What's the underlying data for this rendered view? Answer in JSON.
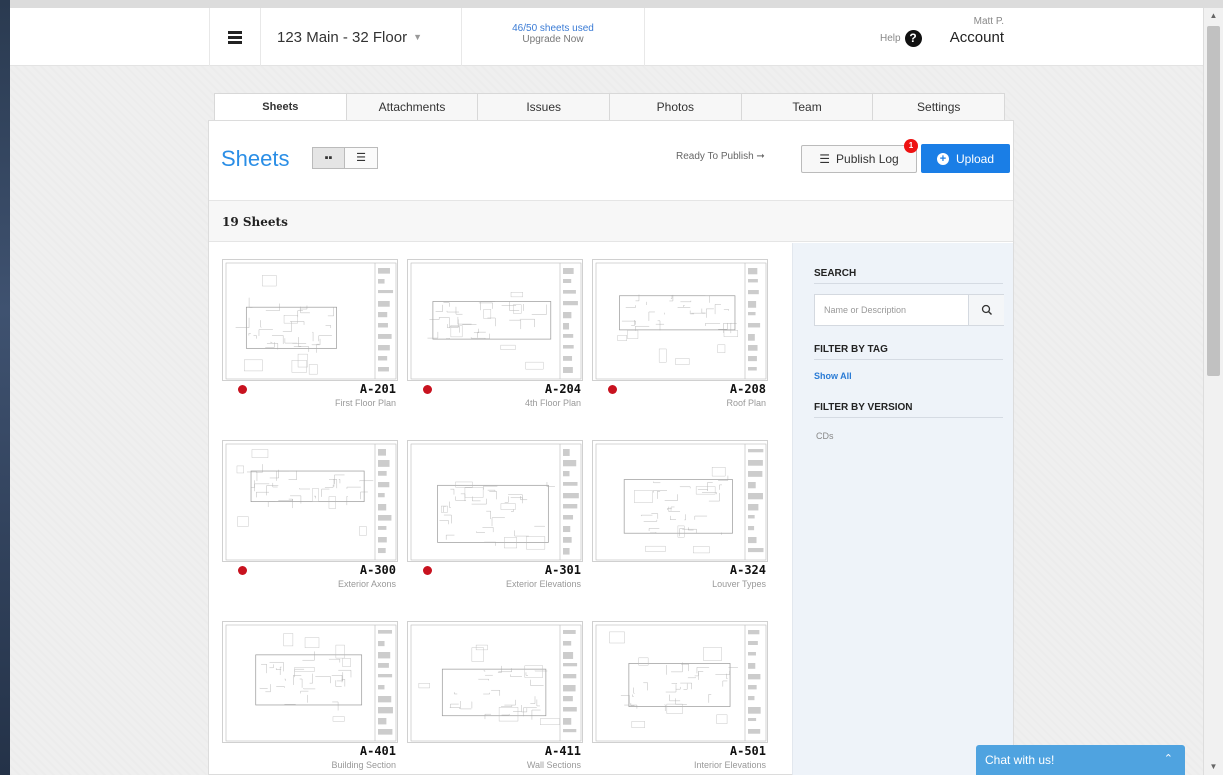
{
  "header": {
    "project_name": "123 Main - 32 Floor",
    "sheets_used": "46/50 sheets used",
    "upgrade": "Upgrade Now",
    "help": "Help",
    "user": "Matt P.",
    "account": "Account"
  },
  "tabs": [
    {
      "label": "Sheets",
      "active": true
    },
    {
      "label": "Attachments"
    },
    {
      "label": "Issues"
    },
    {
      "label": "Photos"
    },
    {
      "label": "Team"
    },
    {
      "label": "Settings"
    }
  ],
  "panel": {
    "title": "Sheets",
    "ready": "Ready To Publish ➞",
    "publish_log": "Publish Log",
    "publish_badge": "1",
    "upload": "Upload",
    "count": "19 Sheets"
  },
  "sheets": [
    {
      "code": "A-201",
      "desc": "First Floor Plan",
      "unpublished": true
    },
    {
      "code": "A-204",
      "desc": "4th Floor Plan",
      "unpublished": true
    },
    {
      "code": "A-208",
      "desc": "Roof Plan",
      "unpublished": true
    },
    {
      "code": "A-300",
      "desc": "Exterior Axons",
      "unpublished": true
    },
    {
      "code": "A-301",
      "desc": "Exterior Elevations",
      "unpublished": true
    },
    {
      "code": "A-324",
      "desc": "Louver Types",
      "unpublished": false
    },
    {
      "code": "A-401",
      "desc": "Building Section",
      "unpublished": false
    },
    {
      "code": "A-411",
      "desc": "Wall Sections",
      "unpublished": false
    },
    {
      "code": "A-501",
      "desc": "Interior Elevations",
      "unpublished": false
    }
  ],
  "sidebar": {
    "search_heading": "SEARCH",
    "search_placeholder": "Name or Description",
    "tag_heading": "FILTER BY TAG",
    "show_all": "Show All",
    "version_heading": "FILTER BY VERSION",
    "version_item": "CDs"
  },
  "chat": {
    "label": "Chat with us!"
  },
  "colors": {
    "accent": "#1a7ee6",
    "unpublished_dot": "#c8121f",
    "chat": "#4fa3e0"
  }
}
